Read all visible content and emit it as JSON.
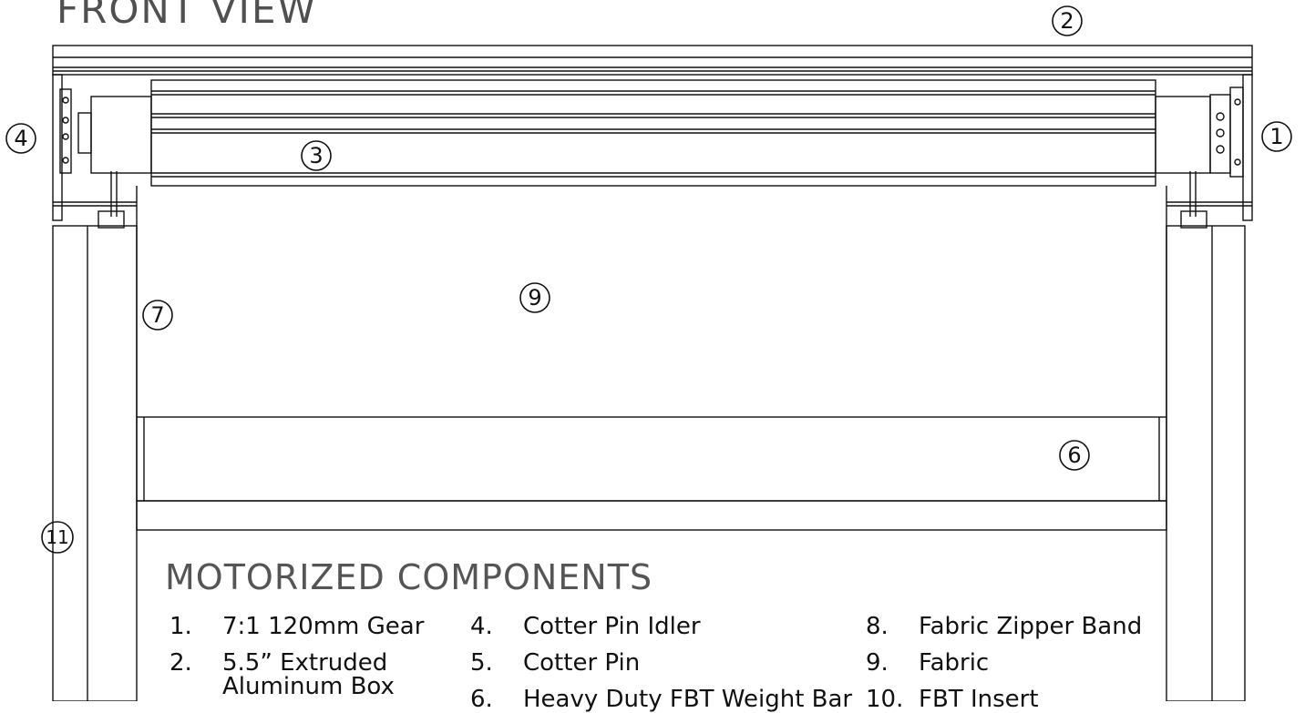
{
  "header": {
    "title": "FRONT VIEW"
  },
  "callouts": [
    "①",
    "②",
    "③",
    "④",
    "⑥",
    "⑦",
    "⑨",
    "⑪"
  ],
  "legend": {
    "title": "MOTORIZED COMPONENTS",
    "items": [
      {
        "num": "1.",
        "label": "7:1 120mm Gear"
      },
      {
        "num": "2.",
        "label": "5.5” Extruded",
        "label2": "Aluminum Box"
      },
      {
        "num": "4.",
        "label": "Cotter Pin Idler"
      },
      {
        "num": "5.",
        "label": "Cotter Pin"
      },
      {
        "num": "6.",
        "label": "Heavy Duty FBT Weight Bar"
      },
      {
        "num": "8.",
        "label": "Fabric Zipper Band"
      },
      {
        "num": "9.",
        "label": "Fabric"
      },
      {
        "num": "10.",
        "label": "FBT Insert"
      }
    ]
  },
  "colors": {
    "line": "#111111",
    "title": "#505050"
  }
}
